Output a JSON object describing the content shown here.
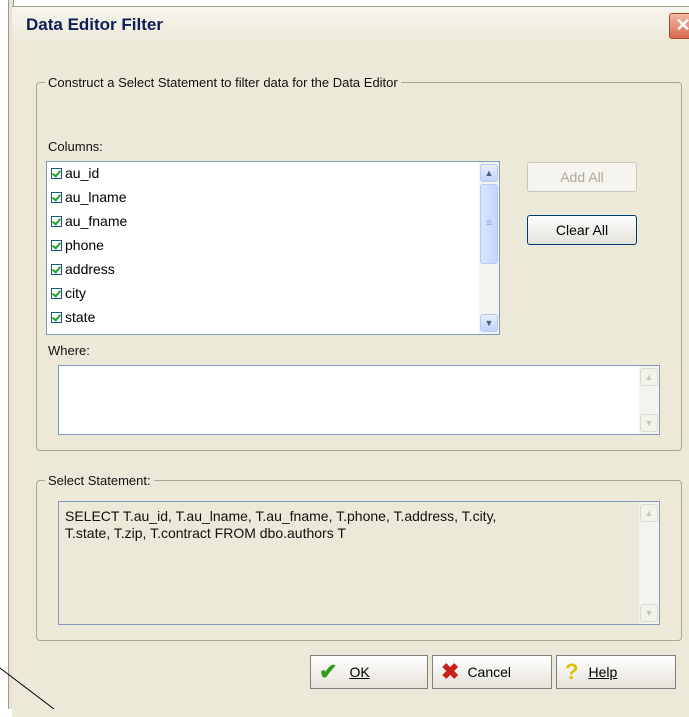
{
  "dialog": {
    "title": "Data Editor Filter",
    "close_icon": "close-icon"
  },
  "filter_group": {
    "legend": "Construct a Select Statement to filter data for the Data Editor",
    "columns_label": "Columns:",
    "columns": [
      {
        "name": "au_id",
        "checked": true
      },
      {
        "name": "au_lname",
        "checked": true
      },
      {
        "name": "au_fname",
        "checked": true
      },
      {
        "name": "phone",
        "checked": true
      },
      {
        "name": "address",
        "checked": true
      },
      {
        "name": "city",
        "checked": true
      },
      {
        "name": "state",
        "checked": true
      }
    ],
    "add_all_label": "Add All",
    "add_all_enabled": false,
    "clear_all_label": "Clear All",
    "where_label": "Where:",
    "where_value": ""
  },
  "statement_group": {
    "legend": "Select Statement:",
    "line1": "SELECT T.au_id, T.au_lname, T.au_fname, T.phone, T.address, T.city,",
    "line2": "T.state, T.zip, T.contract FROM dbo.authors T"
  },
  "footer": {
    "ok_label": "OK",
    "cancel_label": "Cancel",
    "help_label": "Help"
  },
  "colors": {
    "dialog_bg": "#ece9d8",
    "title_text": "#0e1e57",
    "close_button": "#d86a4f",
    "checkbox_mark": "#21a121",
    "ok_icon": "#2e9a1e",
    "cancel_icon": "#c8201a",
    "help_icon": "#e0c000"
  }
}
